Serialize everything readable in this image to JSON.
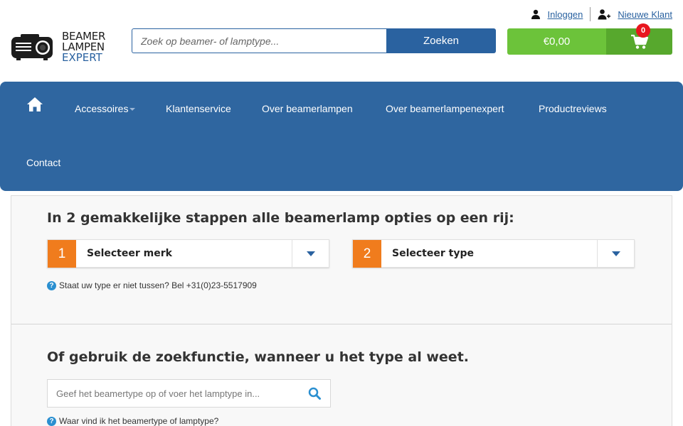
{
  "header": {
    "login_label": "Inloggen",
    "new_customer_label": "Nieuwe Klant",
    "logo": {
      "line1": "BEAMER",
      "line2": "LAMPEN",
      "line3": "EXPERT"
    },
    "search": {
      "placeholder": "Zoek op beamer- of lamptype...",
      "button_label": "Zoeken"
    },
    "cart": {
      "amount": "€0,00",
      "count": "0"
    }
  },
  "nav": {
    "items": [
      {
        "label": "Accessoires"
      },
      {
        "label": "Klantenservice"
      },
      {
        "label": "Over beamerlampen"
      },
      {
        "label": "Over beamerlampenexpert"
      },
      {
        "label": "Productreviews"
      },
      {
        "label": "Contact"
      }
    ]
  },
  "finder": {
    "title": "In 2 gemakkelijke stappen alle beamerlamp opties op een rij:",
    "step1": {
      "number": "1",
      "label": "Selecteer merk"
    },
    "step2": {
      "number": "2",
      "label": "Selecteer type"
    },
    "help_text": "Staat uw type er niet tussen? Bel +31(0)23-5517909"
  },
  "search_section": {
    "title": "Of gebruik de zoekfunctie, wanneer u het type al weet.",
    "placeholder": "Geef het beamertype op of voer het lamptype in...",
    "help_text": "Waar vind ik het beamertype of lamptype?"
  },
  "colors": {
    "brand_blue": "#2f66a0",
    "cart_green": "#6cc33a",
    "cart_green_dark": "#57a82d",
    "step_orange": "#f07c1d",
    "badge_red": "#e8161e"
  }
}
